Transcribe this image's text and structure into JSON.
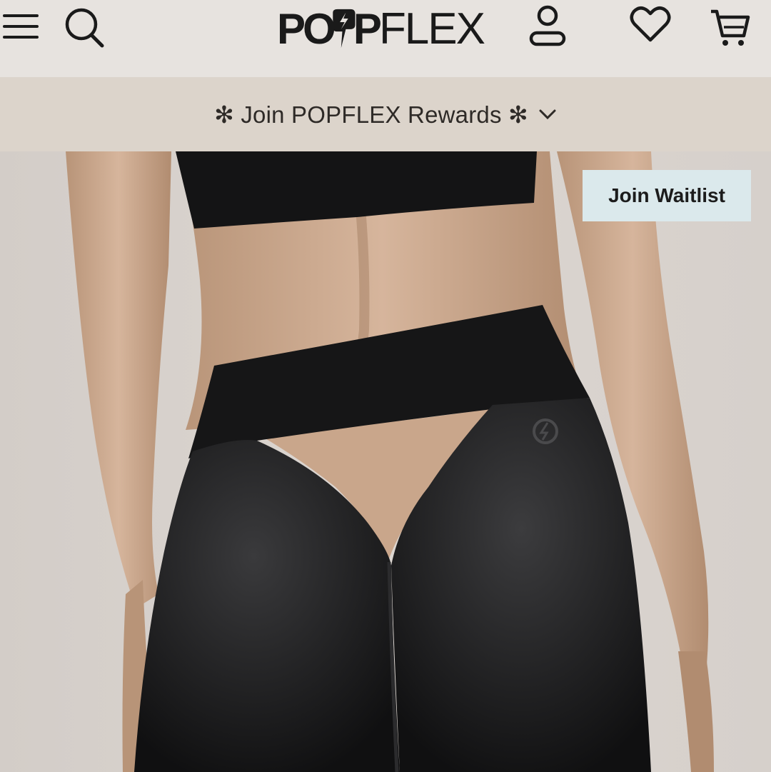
{
  "header": {
    "logo_left": "PO",
    "logo_right": "FLEX",
    "icons": {
      "menu": "hamburger-menu-icon",
      "search": "search-icon",
      "account": "user-account-icon",
      "wishlist": "heart-icon",
      "cart": "shopping-cart-icon",
      "logo_bolt": "lightning-bolt-icon"
    }
  },
  "rewards_banner": {
    "label": "✻ Join POPFLEX Rewards ✻",
    "icon": "chevron-down-icon"
  },
  "hero": {
    "image_icon": "product-photo-leggings",
    "waitlist_button": "Join Waitlist"
  },
  "colors": {
    "header_bg": "#e7e3df",
    "banner_bg": "#dcd4cb",
    "waitlist_bg": "#dbe9ec",
    "text_dark": "#1a1a1a"
  }
}
